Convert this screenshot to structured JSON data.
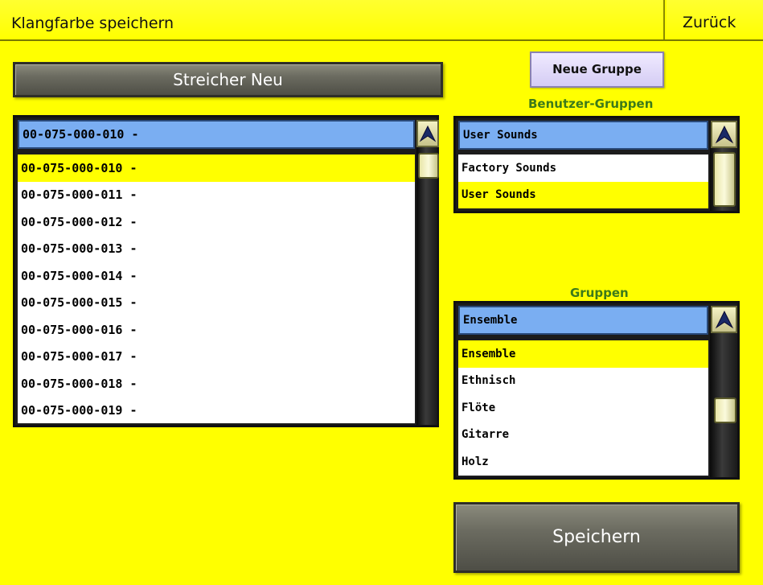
{
  "header": {
    "title": "Klangfarbe speichern",
    "back_label": "Zurück"
  },
  "name_field": {
    "value": "Streicher Neu"
  },
  "new_group_button": "Neue Gruppe",
  "sound_list": {
    "selected": "00-075-000-010 -",
    "items": [
      "00-075-000-010 -",
      "00-075-000-011 -",
      "00-075-000-012 -",
      "00-075-000-013 -",
      "00-075-000-014 -",
      "00-075-000-015 -",
      "00-075-000-016 -",
      "00-075-000-017 -",
      "00-075-000-018 -",
      "00-075-000-019 -"
    ],
    "selected_index": 0
  },
  "user_groups": {
    "label": "Benutzer-Gruppen",
    "selected": "User Sounds",
    "items": [
      "Factory Sounds",
      "User Sounds"
    ],
    "selected_index": 1
  },
  "groups": {
    "label": "Gruppen",
    "selected": "Ensemble",
    "items": [
      "Ensemble",
      "Ethnisch",
      "Flöte",
      "Gitarre",
      "Holz"
    ],
    "selected_index": 0
  },
  "save_button": "Speichern",
  "colors": {
    "background": "#ffff00",
    "selection_bar": "#7aaef2",
    "label_green": "#3c7a1a"
  },
  "icons": {
    "scroll_up": "arrow-up-icon"
  }
}
